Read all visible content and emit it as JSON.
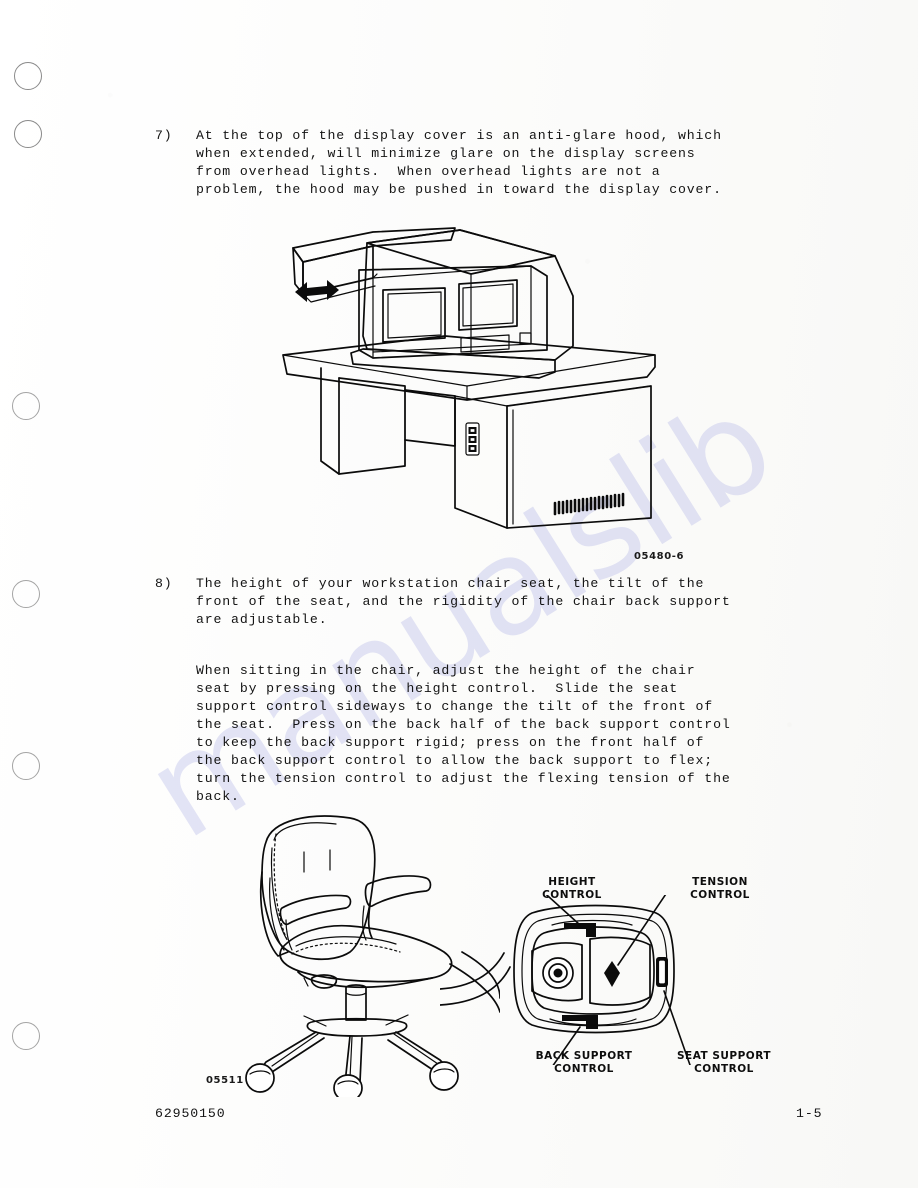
{
  "document": {
    "page_number": "1-5",
    "document_number": "62950150",
    "watermark": "manualslib"
  },
  "items": [
    {
      "marker": "7)",
      "lines": [
        "At the top of the display cover is an anti-glare hood, which",
        "when extended, will minimize glare on the display screens",
        "from overhead lights.  When overhead lights are not a",
        "problem, the hood may be pushed in toward the display cover."
      ]
    },
    {
      "marker": "8)",
      "lines": [
        "The height of your workstation chair seat, the tilt of the",
        "front of the seat, and the rigidity of the chair back support",
        "are adjustable."
      ]
    }
  ],
  "paragraph_2": {
    "lines": [
      "When sitting in the chair, adjust the height of the chair",
      "seat by pressing on the height control.  Slide the seat",
      "support control sideways to change the tilt of the front of",
      "the seat.  Press on the back half of the back support control",
      "to keep the back support rigid; press on the front half of",
      "the back support control to allow the back support to flex;",
      "turn the tension control to adjust the flexing tension of the",
      "back."
    ]
  },
  "figures": [
    {
      "id": "05480-6",
      "name": "workstation-desk-illustration",
      "caption_id_position": "right"
    },
    {
      "id": "05511",
      "name": "office-chair-illustration",
      "caption_id_position": "left"
    }
  ],
  "chair_controls": {
    "height_control": "HEIGHT\nCONTROL",
    "tension_control": "TENSION\nCONTROL",
    "back_support_control": "BACK SUPPORT\nCONTROL",
    "seat_support_control": "SEAT SUPPORT\nCONTROL"
  },
  "colors": {
    "ink": "#0b0b0b",
    "paper": "#fdfdfc",
    "watermark": "#787ed8"
  }
}
